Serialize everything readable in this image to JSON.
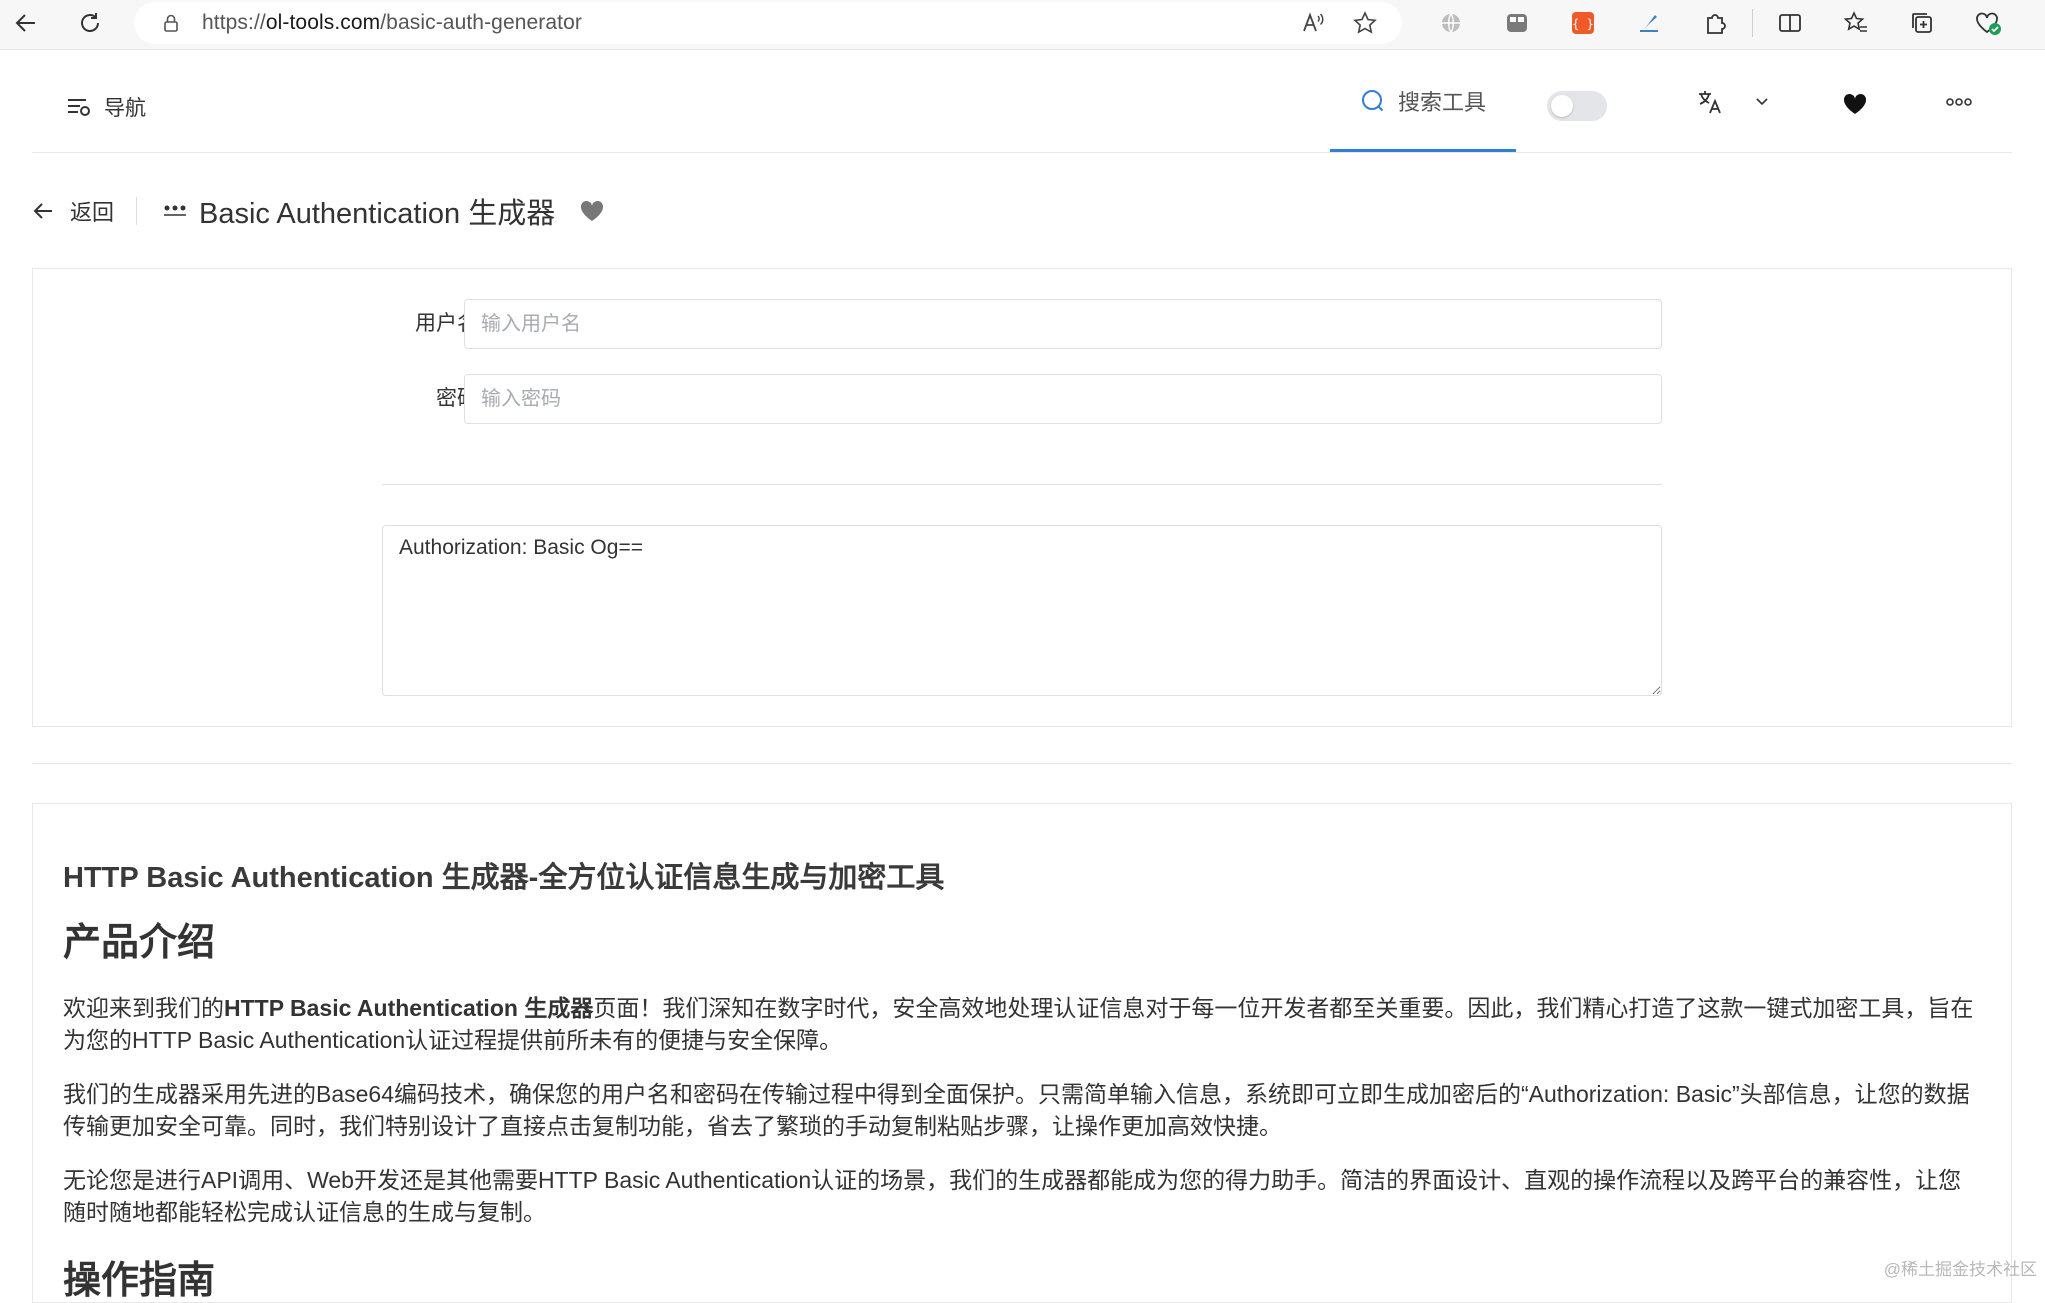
{
  "browser": {
    "url_prefix": "https://",
    "url_host": "ol-tools.com",
    "url_path": "/basic-auth-generator"
  },
  "header": {
    "nav_label": "导航",
    "search_label": "搜索工具",
    "accent_color": "#2f7fd6"
  },
  "title_row": {
    "back_label": "返回",
    "tool_title": "Basic Authentication 生成器"
  },
  "form": {
    "username_label": "用户名",
    "username_placeholder": "输入用户名",
    "password_label": "密码",
    "password_placeholder": "输入密码",
    "output_value": "Authorization: Basic Og=="
  },
  "description": {
    "heading": "HTTP Basic Authentication 生成器-全方位认证信息生成与加密工具",
    "section1_title": "产品介绍",
    "p1_before": "欢迎来到我们的",
    "p1_bold": "HTTP Basic Authentication 生成器",
    "p1_after": "页面！我们深知在数字时代，安全高效地处理认证信息对于每一位开发者都至关重要。因此，我们精心打造了这款一键式加密工具，旨在为您的HTTP Basic Authentication认证过程提供前所未有的便捷与安全保障。",
    "p2": "我们的生成器采用先进的Base64编码技术，确保您的用户名和密码在传输过程中得到全面保护。只需简单输入信息，系统即可立即生成加密后的“Authorization: Basic”头部信息，让您的数据传输更加安全可靠。同时，我们特别设计了直接点击复制功能，省去了繁琐的手动复制粘贴步骤，让操作更加高效快捷。",
    "p3": "无论您是进行API调用、Web开发还是其他需要HTTP Basic Authentication认证的场景，我们的生成器都能成为您的得力助手。简洁的界面设计、直观的操作流程以及跨平台的兼容性，让您随时随地都能轻松完成认证信息的生成与复制。",
    "section2_title": "操作指南"
  },
  "watermark": "@稀土掘金技术社区"
}
